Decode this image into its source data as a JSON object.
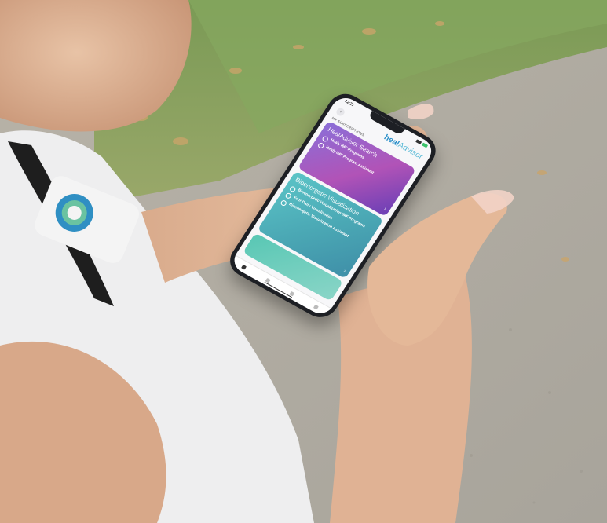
{
  "phone": {
    "status_time": "12:21",
    "logo_part1": "heal",
    "logo_part2": "Advisor",
    "section_label": "MY SUBSCRIPTIONS",
    "cards": [
      {
        "title": "HealAdvisor Search",
        "items": [
          "Healy IMF Programs",
          "Healy IMF Program Assistant"
        ]
      },
      {
        "title": "Bioenergetic Visualization",
        "items": [
          "Bioenergetic Visualization IMF Programs",
          "Your Daily Visualization",
          "Bioenergetic Visualization Assistant"
        ]
      },
      {
        "title": "",
        "items": []
      }
    ]
  },
  "colors": {
    "search_card": "#9a5fc8",
    "bio_card": "#4fb3bd",
    "logo": "#2a8fc9"
  },
  "icons": [
    "back-icon",
    "signal-icon",
    "battery-icon",
    "search-icon",
    "visualization-icon",
    "chevron-right-icon",
    "home-icon",
    "nav-icon"
  ]
}
